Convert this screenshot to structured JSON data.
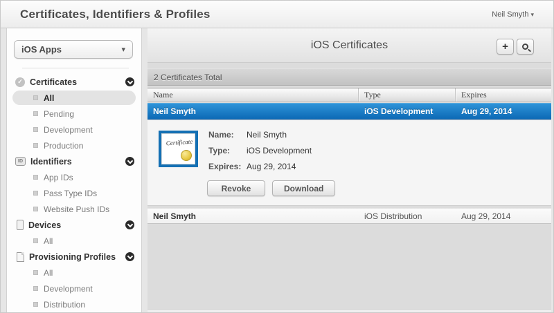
{
  "header": {
    "title": "Certificates, Identifiers & Profiles",
    "user_menu": "Neil Smyth",
    "user_menu_arrow": "▾"
  },
  "sidebar": {
    "team_selector": "iOS Apps",
    "team_selector_arrow": "▾",
    "sections": [
      {
        "label": "Certificates",
        "icon": "certificate-seal-icon",
        "items": [
          {
            "label": "All",
            "selected": true
          },
          {
            "label": "Pending"
          },
          {
            "label": "Development"
          },
          {
            "label": "Production"
          }
        ]
      },
      {
        "label": "Identifiers",
        "icon": "id-badge-icon",
        "items": [
          {
            "label": "App IDs"
          },
          {
            "label": "Pass Type IDs"
          },
          {
            "label": "Website Push IDs"
          }
        ]
      },
      {
        "label": "Devices",
        "icon": "device-icon",
        "items": [
          {
            "label": "All"
          }
        ]
      },
      {
        "label": "Provisioning Profiles",
        "icon": "document-icon",
        "items": [
          {
            "label": "All"
          },
          {
            "label": "Development"
          },
          {
            "label": "Distribution"
          }
        ]
      }
    ]
  },
  "icons": {
    "seal_check": "✓",
    "id_label": "ID",
    "add": "+",
    "search": "magnifier-icon",
    "chevron_circle": "chevron-down-circle-icon"
  },
  "main": {
    "title": "iOS Certificates",
    "summary": "2 Certificates Total",
    "table": {
      "columns": [
        "Name",
        "Type",
        "Expires"
      ],
      "rows": [
        {
          "name": "Neil Smyth",
          "type": "iOS Development",
          "expires": "Aug 29, 2014",
          "selected": true
        },
        {
          "name": "Neil Smyth",
          "type": "iOS Distribution",
          "expires": "Aug 29, 2014",
          "selected": false
        }
      ]
    },
    "detail": {
      "thumbnail_label": "Certificate",
      "fields": [
        {
          "label": "Name:",
          "value": "Neil Smyth"
        },
        {
          "label": "Type:",
          "value": "iOS Development"
        },
        {
          "label": "Expires:",
          "value": "Aug 29, 2014"
        }
      ],
      "buttons": [
        {
          "label": "Revoke"
        },
        {
          "label": "Download"
        }
      ]
    }
  },
  "colors": {
    "selected_row_blue_top": "#2e93d8",
    "selected_row_blue_bottom": "#0d6ab6",
    "cert_thumb_border": "#1470b4",
    "gold_seal": "#e8c943",
    "panel_gray": "#dcdcdc"
  }
}
